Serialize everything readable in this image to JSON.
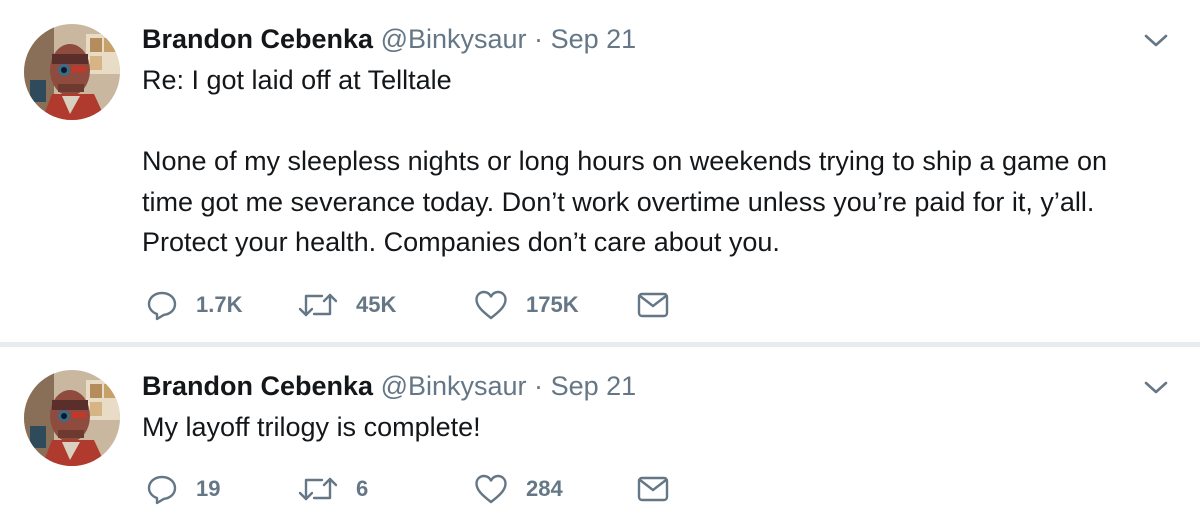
{
  "tweets": [
    {
      "author_name": "Brandon Cebenka",
      "handle": "@Binkysaur",
      "separator": "·",
      "date": "Sep 21",
      "text_lines": [
        "Re: I got laid off at Telltale",
        "None of my sleepless nights or long hours on weekends trying to ship a game on",
        "time got me severance today. Don’t work overtime unless you’re paid for it, y’all.",
        "Protect your health. Companies don’t care about you."
      ],
      "replies": "1.7K",
      "retweets": "45K",
      "likes": "175K"
    },
    {
      "author_name": "Brandon Cebenka",
      "handle": "@Binkysaur",
      "separator": "·",
      "date": "Sep 21",
      "text_lines": [
        "My layoff trilogy is complete!"
      ],
      "replies": "19",
      "retweets": "6",
      "likes": "284"
    }
  ],
  "icons": {
    "reply": "reply-icon",
    "retweet": "retweet-icon",
    "like": "heart-icon",
    "message": "direct-message-icon",
    "more": "chevron-down-icon"
  },
  "colors": {
    "text": "#14171a",
    "secondary": "#657786",
    "separator": "#e6ecf0"
  }
}
